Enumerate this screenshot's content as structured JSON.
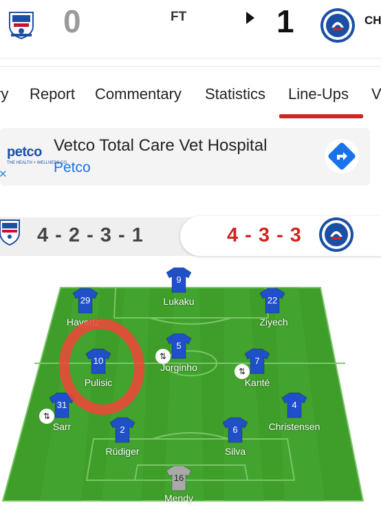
{
  "match": {
    "status": "FT",
    "home_score": "0",
    "away_score": "1",
    "away_abbr": "CH"
  },
  "tabs": [
    {
      "label": "ry"
    },
    {
      "label": "Report"
    },
    {
      "label": "Commentary"
    },
    {
      "label": "Statistics"
    },
    {
      "label": "Line-Ups",
      "active": true
    },
    {
      "label": "V"
    }
  ],
  "ad": {
    "logo_text": "petco",
    "logo_sub": "THE HEALTH + WELLNESS CO.",
    "title": "Vetco Total Care Vet Hospital",
    "subtitle": "Petco",
    "directions_icon": "directions-icon"
  },
  "formations": {
    "home": "4 - 2 - 3 - 1",
    "away": "4 - 3 - 3"
  },
  "colors": {
    "accent": "#d0251f",
    "pitch": "#3f9e2a",
    "jersey": "#1f4fc9",
    "goalkeeper": "#a9a9a9",
    "highlight": "#f2443a"
  },
  "players": [
    {
      "num": "9",
      "name": "Lukaku"
    },
    {
      "num": "29",
      "name": "Havertz"
    },
    {
      "num": "22",
      "name": "Ziyech"
    },
    {
      "num": "5",
      "name": "Jorginho",
      "sub": true
    },
    {
      "num": "10",
      "name": "Pulisic"
    },
    {
      "num": "7",
      "name": "Kanté",
      "sub": true
    },
    {
      "num": "31",
      "name": "Sarr",
      "sub": true
    },
    {
      "num": "4",
      "name": "Christensen"
    },
    {
      "num": "2",
      "name": "Rüdiger"
    },
    {
      "num": "6",
      "name": "Silva"
    },
    {
      "num": "16",
      "name": "Mendy",
      "gk": true
    }
  ]
}
